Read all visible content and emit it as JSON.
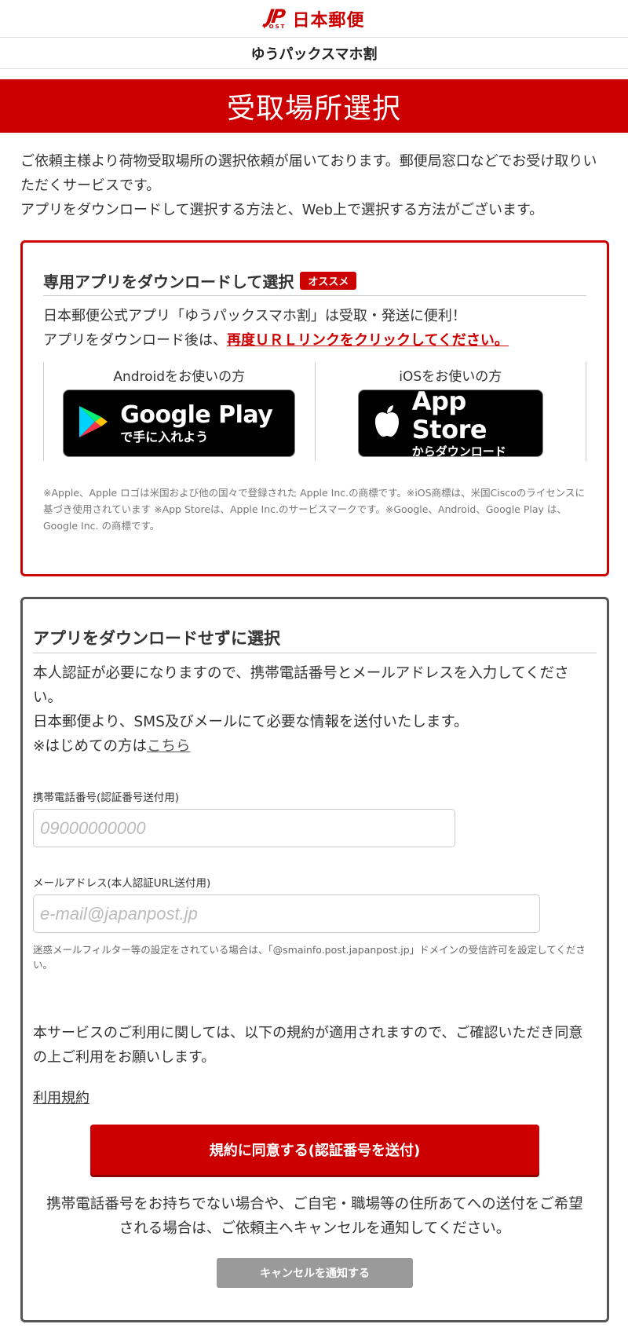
{
  "header": {
    "logo_mark": "JP",
    "logo_post": "POST",
    "logo_text": "日本郵便",
    "service_name": "ゆうパックスマホ割"
  },
  "title": "受取場所選択",
  "intro": {
    "line1": "ご依頼主様より荷物受取場所の選択依頼が届いております。郵便局窓口などでお受け取りいただくサービスです。",
    "line2": "アプリをダウンロードして選択する方法と、Web上で選択する方法がございます。"
  },
  "app_section": {
    "heading": "専用アプリをダウンロードして選択",
    "badge": "オススメ",
    "desc_line1": "日本郵便公式アプリ「ゆうパックスマホ割」は受取・発送に便利！",
    "desc_line2_prefix": "アプリをダウンロード後は、",
    "desc_line2_emphasis": "再度ＵＲＬリンクをクリックしてください。",
    "android_label": "Androidをお使いの方",
    "ios_label": "iOSをお使いの方",
    "google_play_big": "Google Play",
    "google_play_small": "で手に入れよう",
    "app_store_big": "App Store",
    "app_store_small": "からダウンロード",
    "trademark": "※Apple、Apple ロゴは米国および他の国々で登録された Apple Inc.の商標です。※iOS商標は、米国Ciscoのライセンスに基づき使用されています ※App Storeは、Apple Inc.のサービスマークです。※Google、Android、Google Play は、Google Inc. の商標です。"
  },
  "web_section": {
    "heading": "アプリをダウンロードせずに選択",
    "desc_line1": "本人認証が必要になりますので、携帯電話番号とメールアドレスを入力してください。",
    "desc_line2": "日本郵便より、SMS及びメールにて必要な情報を送付いたします。",
    "desc_line3_prefix": "※はじめての方は",
    "desc_line3_link": "こちら",
    "phone_label": "携帯電話番号(認証番号送付用)",
    "phone_placeholder": "09000000000",
    "email_label": "メールアドレス(本人認証URL送付用)",
    "email_placeholder": "e-mail@japanpost.jp",
    "filter_note": "迷惑メールフィルター等の設定をされている場合は、「@smainfo.post.japanpost.jp」ドメインの受信許可を設定してください。",
    "terms_text": "本サービスのご利用に関しては、以下の規約が適用されますので、ご確認いただき同意の上ご利用をお願いします。",
    "terms_link": "利用規約",
    "agree_button": "規約に同意する(認証番号を送付)",
    "cancel_text": "携帯電話番号をお持ちでない場合や、ご自宅・職場等の住所あてへの送付をご希望される場合は、ご依頼主へキャンセルを通知してください。",
    "cancel_button": "キャンセルを通知する"
  },
  "colors": {
    "brand_red": "#cc0000",
    "border_gray": "#555555",
    "button_gray": "#9a9a9a"
  }
}
